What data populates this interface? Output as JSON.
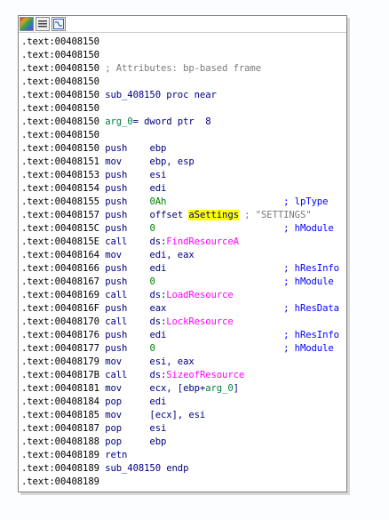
{
  "toolbar": {
    "buttons": [
      {
        "icon": "graph-view-icon"
      },
      {
        "icon": "text-view-icon"
      },
      {
        "icon": "proximity-view-icon"
      }
    ]
  },
  "listing": [
    {
      "addr": ".text:00408150"
    },
    {
      "addr": ".text:00408150"
    },
    {
      "addr": ".text:00408150",
      "comment": "; Attributes: bp-based frame"
    },
    {
      "addr": ".text:00408150"
    },
    {
      "addr": ".text:00408150",
      "label": "sub_408150 proc near"
    },
    {
      "addr": ".text:00408150"
    },
    {
      "addr": ".text:00408150",
      "arg_name": "arg_0",
      "arg_def": "= dword ptr  8"
    },
    {
      "addr": ".text:00408150"
    },
    {
      "addr": ".text:00408150",
      "mnem": "push",
      "op": "ebp"
    },
    {
      "addr": ".text:00408151",
      "mnem": "mov",
      "op": "ebp, esp"
    },
    {
      "addr": ".text:00408153",
      "mnem": "push",
      "op": "esi"
    },
    {
      "addr": ".text:00408154",
      "mnem": "push",
      "op": "edi"
    },
    {
      "addr": ".text:00408155",
      "mnem": "push",
      "op_num": "0Ah",
      "comment_b": "; lpType"
    },
    {
      "addr": ".text:00408157",
      "mnem": "push",
      "op_pre": "offset ",
      "op_hl": "aSettings",
      "comment_g": " ; \"SETTINGS\""
    },
    {
      "addr": ".text:0040815C",
      "mnem": "push",
      "op_num": "0",
      "comment_b": "; hModule"
    },
    {
      "addr": ".text:0040815E",
      "mnem": "call",
      "op_pre": "ds:",
      "op_api": "FindResourceA"
    },
    {
      "addr": ".text:00408164",
      "mnem": "mov",
      "op": "edi, eax"
    },
    {
      "addr": ".text:00408166",
      "mnem": "push",
      "op": "edi",
      "comment_b": "; hResInfo"
    },
    {
      "addr": ".text:00408167",
      "mnem": "push",
      "op_num": "0",
      "comment_b": "; hModule"
    },
    {
      "addr": ".text:00408169",
      "mnem": "call",
      "op_pre": "ds:",
      "op_api": "LoadResource"
    },
    {
      "addr": ".text:0040816F",
      "mnem": "push",
      "op": "eax",
      "comment_b": "; hResData"
    },
    {
      "addr": ".text:00408170",
      "mnem": "call",
      "op_pre": "ds:",
      "op_api": "LockResource"
    },
    {
      "addr": ".text:00408176",
      "mnem": "push",
      "op": "edi",
      "comment_b": "; hResInfo"
    },
    {
      "addr": ".text:00408177",
      "mnem": "push",
      "op_num": "0",
      "comment_b": "; hModule"
    },
    {
      "addr": ".text:00408179",
      "mnem": "mov",
      "op": "esi, eax"
    },
    {
      "addr": ".text:0040817B",
      "mnem": "call",
      "op_pre": "ds:",
      "op_api": "SizeofResource"
    },
    {
      "addr": ".text:00408181",
      "mnem": "mov",
      "op_pre": "ecx, [ebp+",
      "op_arg": "arg_0",
      "op_post": "]"
    },
    {
      "addr": ".text:00408184",
      "mnem": "pop",
      "op": "edi"
    },
    {
      "addr": ".text:00408185",
      "mnem": "mov",
      "op": "[ecx], esi"
    },
    {
      "addr": ".text:00408187",
      "mnem": "pop",
      "op": "esi"
    },
    {
      "addr": ".text:00408188",
      "mnem": "pop",
      "op": "ebp"
    },
    {
      "addr": ".text:00408189",
      "mnem": "retn"
    },
    {
      "addr": ".text:00408189",
      "label": "sub_408150 endp"
    },
    {
      "addr": ".text:00408189"
    }
  ]
}
